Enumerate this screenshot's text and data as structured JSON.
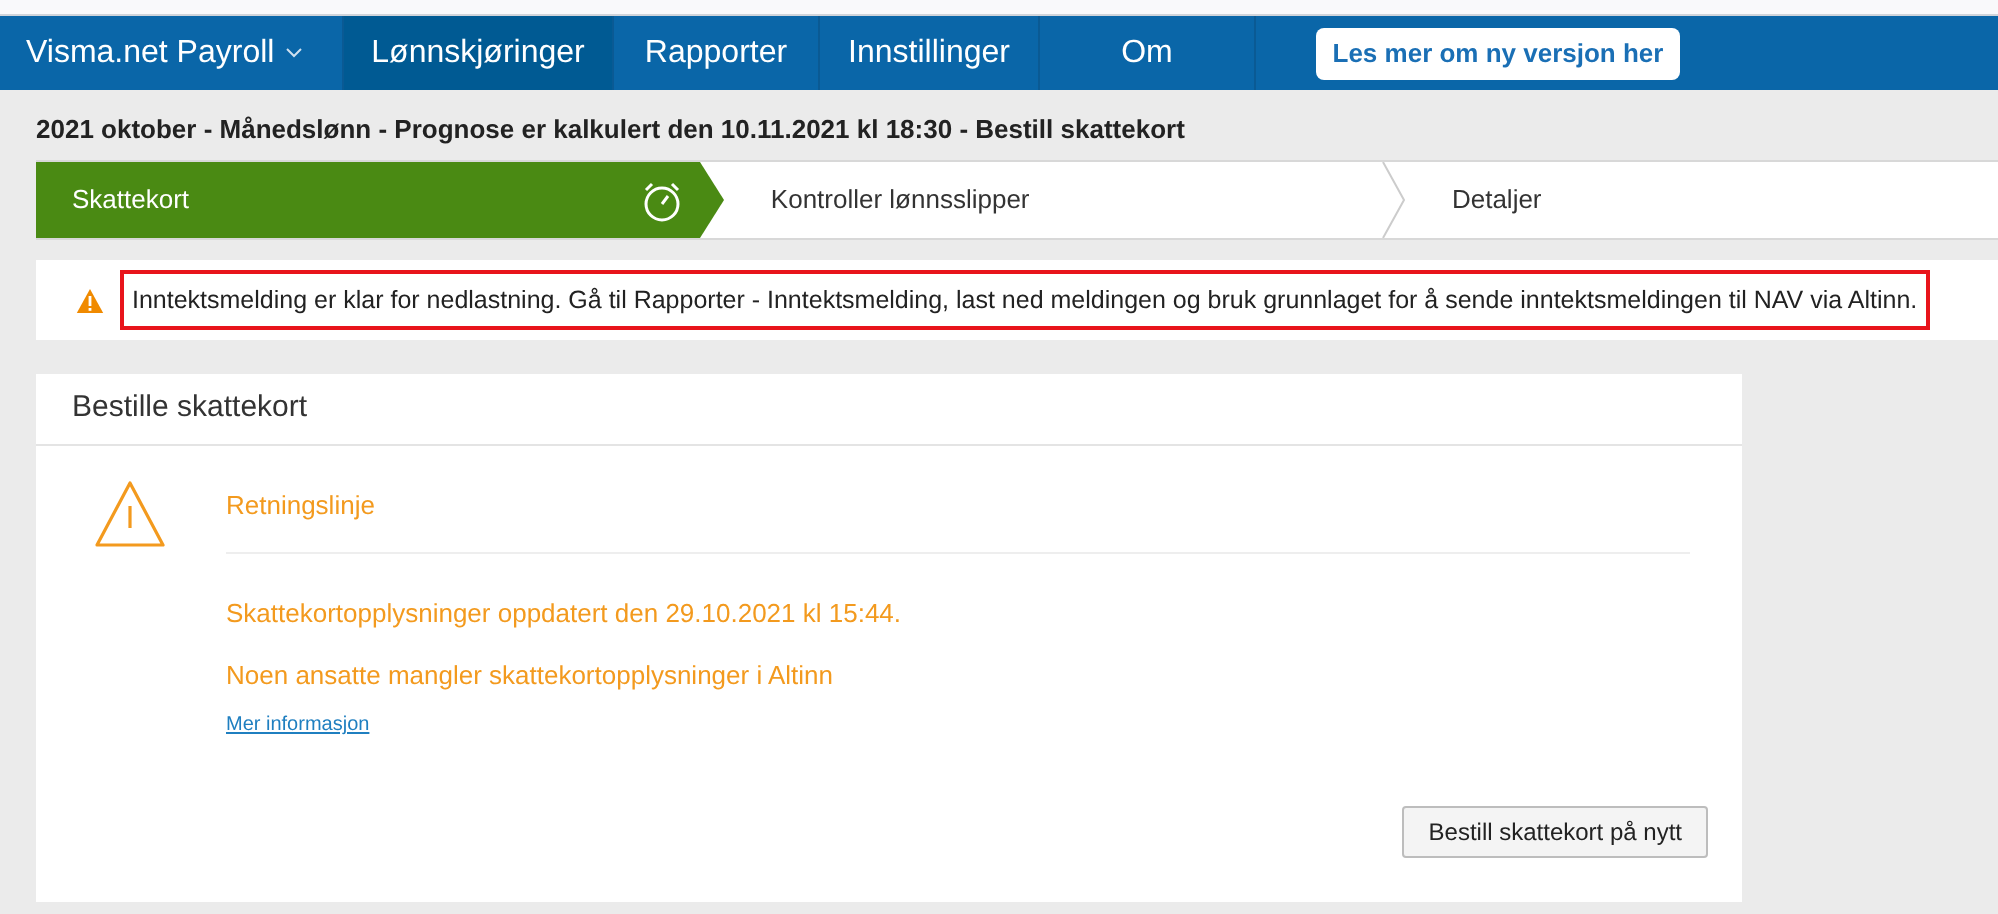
{
  "nav": {
    "brand": "Visma.net Payroll",
    "items": [
      {
        "label": "Lønnskjøringer",
        "selected": true
      },
      {
        "label": "Rapporter",
        "selected": false
      },
      {
        "label": "Innstillinger",
        "selected": false
      },
      {
        "label": "Om",
        "selected": false
      }
    ],
    "button": "Les mer om ny versjon her"
  },
  "page_title": "2021 oktober - Månedslønn - Prognose er kalkulert den 10.11.2021 kl 18:30 - Bestill skattekort",
  "steps": [
    {
      "label": "Skattekort",
      "selected": true
    },
    {
      "label": "Kontroller lønnsslipper",
      "selected": false
    },
    {
      "label": "Detaljer",
      "selected": false
    }
  ],
  "alert": {
    "text": "Inntektsmelding er klar for nedlastning. Gå til Rapporter - Inntektsmelding, last ned meldingen og bruk grunnlaget for å sende inntektsmeldingen til NAV via Altinn.",
    "highlighted": true
  },
  "card": {
    "title": "Bestille skattekort",
    "heading": "Retningslinje",
    "lines": [
      "Skattekortopplysninger oppdatert den 29.10.2021 kl 15:44.",
      "Noen ansatte mangler skattekortopplysninger i Altinn"
    ],
    "link": "Mer informasjon",
    "button": "Bestill skattekort på nytt"
  }
}
